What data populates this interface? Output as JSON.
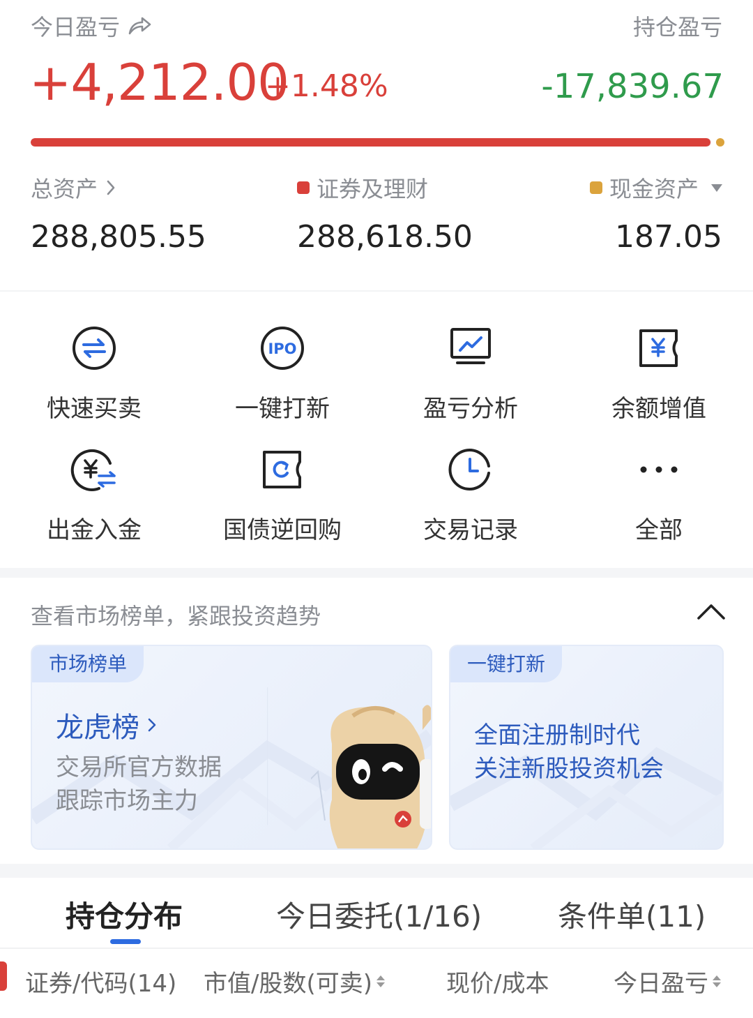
{
  "summary": {
    "today_pnl_label": "今日盈亏",
    "today_pnl_value": "+4,212.00",
    "today_pnl_pct": "+1.48%",
    "holding_pnl_label": "持仓盈亏",
    "holding_pnl_value": "-17,839.67",
    "allocation_bar": {
      "securities_fraction": 0.9994,
      "securities_color": "#d9403a",
      "cash_color": "#dba33c"
    }
  },
  "assets": {
    "total_label": "总资产",
    "total_value": "288,805.55",
    "securities_label": "证券及理财",
    "securities_value": "288,618.50",
    "cash_label": "现金资产",
    "cash_value": "187.05"
  },
  "functions": [
    {
      "label": "快速买卖",
      "icon": "swap-arrows-icon"
    },
    {
      "label": "一键打新",
      "icon": "ipo-icon"
    },
    {
      "label": "盈亏分析",
      "icon": "chart-monitor-icon"
    },
    {
      "label": "余额增值",
      "icon": "yuan-ticket-icon"
    },
    {
      "label": "出金入金",
      "icon": "yuan-transfer-icon"
    },
    {
      "label": "国债逆回购",
      "icon": "repo-ticket-icon"
    },
    {
      "label": "交易记录",
      "icon": "clock-icon"
    },
    {
      "label": "全部",
      "icon": "more-dots-icon"
    }
  ],
  "market": {
    "title": "查看市场榜单，紧跟投资趋势",
    "card1": {
      "tag": "市场榜单",
      "title": "龙虎榜",
      "line1": "交易所官方数据",
      "line2": "跟踪市场主力"
    },
    "card2": {
      "tag": "一键打新",
      "line1": "全面注册制时代",
      "line2": "关注新股投资机会"
    }
  },
  "tabs": [
    {
      "label": "持仓分布",
      "active": true
    },
    {
      "label": "今日委托(1/16)",
      "active": false
    },
    {
      "label": "条件单(11)",
      "active": false
    }
  ],
  "table_headers": {
    "security": "证券/代码(14)",
    "market_value": "市值/股数(可卖)",
    "price": "现价/成本",
    "today_pnl": "今日盈亏"
  }
}
